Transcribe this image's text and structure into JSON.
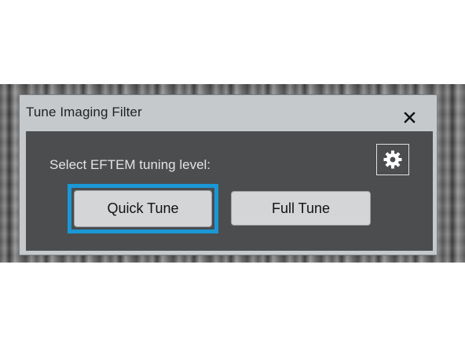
{
  "dialog": {
    "title": "Tune Imaging Filter",
    "close_icon": "close-icon"
  },
  "panel": {
    "prompt": "Select EFTEM tuning level:",
    "settings_icon": "gear-icon",
    "buttons": {
      "quick_tune": "Quick Tune",
      "full_tune": "Full Tune"
    },
    "focused_button": "quick_tune"
  },
  "colors": {
    "dialog_bg": "#c5c9cc",
    "panel_bg": "#4b4d4f",
    "focus_ring": "#1a98d6",
    "button_bg": "#d3d5d7"
  }
}
